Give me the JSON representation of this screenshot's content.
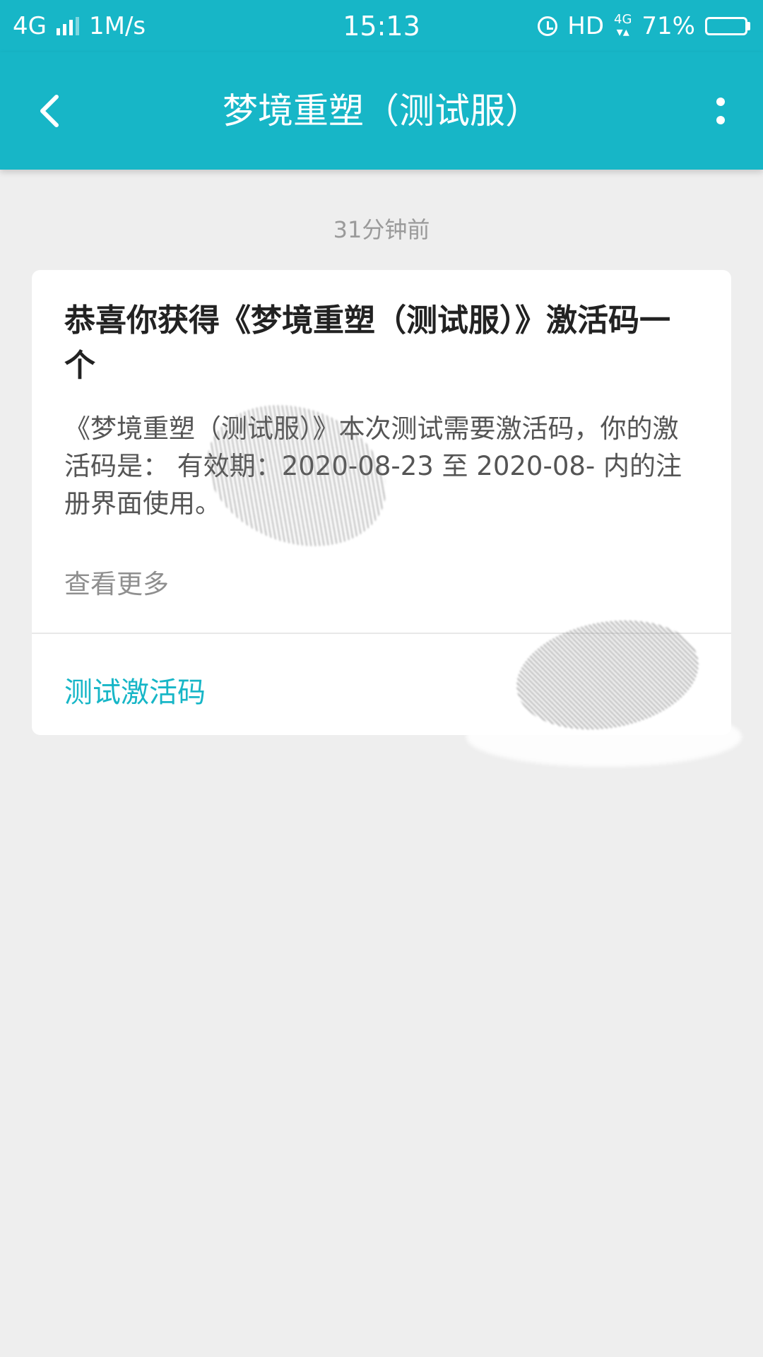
{
  "status_bar": {
    "network": "4G",
    "speed": "1M/s",
    "time": "15:13",
    "hd": "HD",
    "net4g_label": "4G",
    "battery_percent": "71%",
    "battery_level": 0.71,
    "icons": [
      "signal-bars-icon",
      "alarm-icon",
      "battery-icon"
    ]
  },
  "app_bar": {
    "title": "梦境重塑（测试服）",
    "icons": [
      "back-arrow-icon",
      "more-vertical-icon"
    ]
  },
  "timestamp": "31分钟前",
  "card": {
    "title": "恭喜你获得《梦境重塑（测试服）》激活码一个",
    "body": "《梦境重塑（测试服）》本次测试需要激活码，你的激活码是：          有效期：2020-08-23 至 2020-08-          内的注册界面使用。",
    "view_more": "查看更多",
    "code_label": "测试激活码",
    "code_value": ""
  },
  "colors": {
    "accent": "#17b6c7",
    "background": "#eeeeee",
    "card": "#ffffff"
  }
}
